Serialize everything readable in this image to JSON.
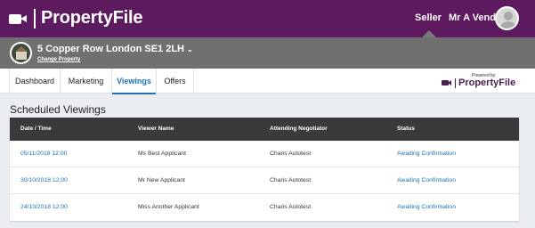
{
  "header": {
    "brand": "PropertyFile",
    "seller_label": "Seller",
    "user_name": "Mr A Vendor",
    "user_chevron": "⌄"
  },
  "property": {
    "address": "5 Copper Row London SE1 2LH",
    "address_chevron": "⌄",
    "change_label": "Change Property"
  },
  "tabs": [
    {
      "label": "Dashboard",
      "active": false
    },
    {
      "label": "Marketing",
      "active": false
    },
    {
      "label": "Viewings",
      "active": true
    },
    {
      "label": "Offers",
      "active": false
    }
  ],
  "powered_by": {
    "label": "Powered by",
    "brand": "PropertyFile"
  },
  "section_title": "Scheduled Viewings",
  "table": {
    "headers": [
      "Date / Time",
      "Viewer Name",
      "Attending Negotiator",
      "Status"
    ],
    "rows": [
      [
        "05/11/2018 12:00",
        "Ms Best Applicant",
        "Charis Autotest",
        "Awaiting Confirmation"
      ],
      [
        "30/10/2018 12:00",
        "Mr New Applicant",
        "Charis Autotest",
        "Awaiting Confirmation"
      ],
      [
        "24/10/2018 12:00",
        "Miss Another Applicant",
        "Charis Autotest",
        "Awaiting Confirmation"
      ]
    ]
  },
  "colors": {
    "brand_purple": "#5d1a5e",
    "property_bar": "#707070",
    "link_blue": "#1f6fb2",
    "table_header": "#3a3a3a"
  }
}
